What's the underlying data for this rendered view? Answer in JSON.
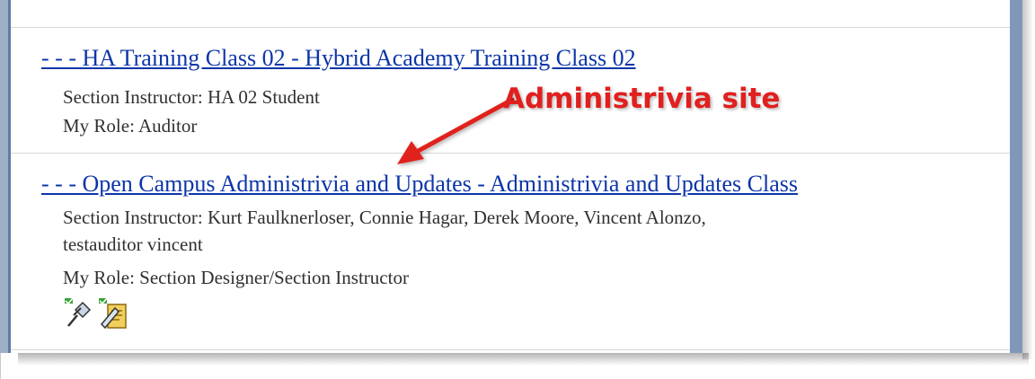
{
  "partial_top_text": "...",
  "courses": [
    {
      "link": "- - - HA Training Class 02 - Hybrid Academy Training Class 02",
      "instructors": "Section Instructor: HA 02 Student",
      "role": "My Role: Auditor"
    },
    {
      "link": "- - - Open Campus Administrivia and Updates - Administrivia and Updates Class",
      "instructors_line1": "Section Instructor: Kurt Faulknerloser, Connie Hagar, Derek Moore, Vincent Alonzo,",
      "instructors_line2": "testauditor vincent",
      "role": "My Role: Section Designer/Section Instructor",
      "icons": [
        "edit-pushpin-icon",
        "designer-tools-icon"
      ]
    }
  ],
  "annotation": {
    "text": "Administrivia site",
    "color": "#e0201f"
  },
  "colors": {
    "link": "#0c35a8",
    "frame": "#7f98b8"
  }
}
